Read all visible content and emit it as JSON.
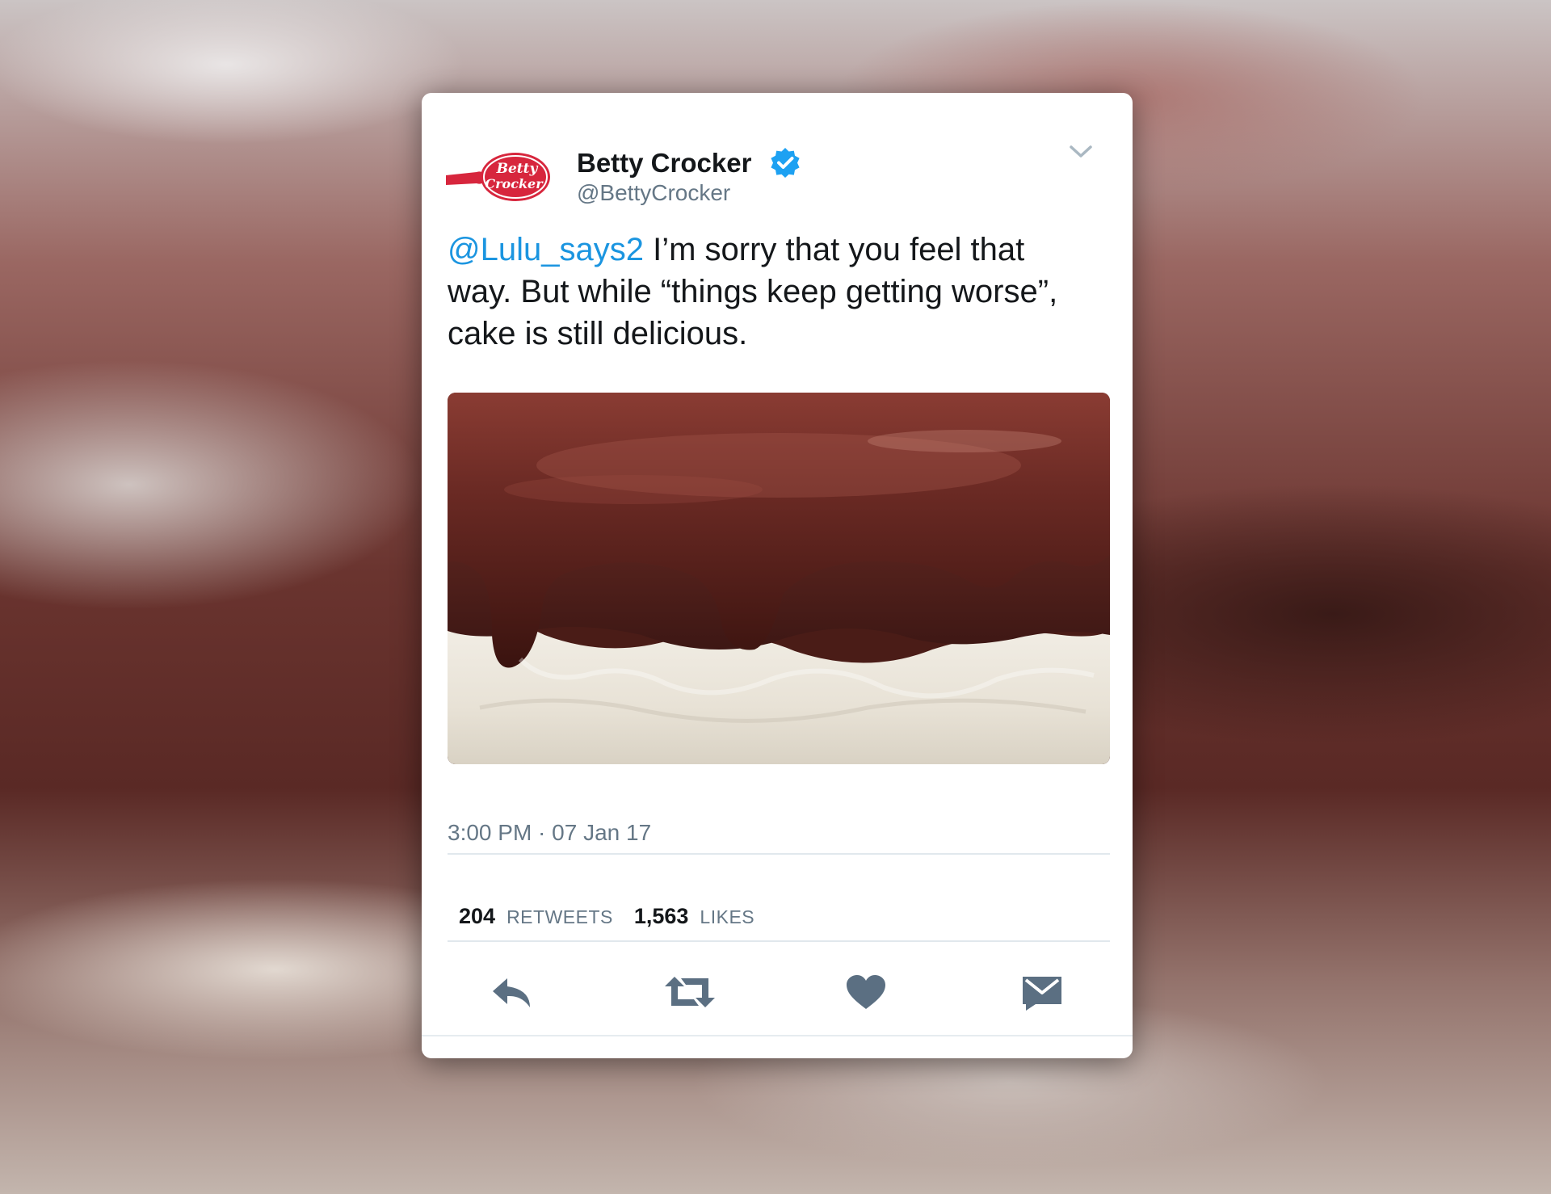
{
  "tweet": {
    "logo_text_line1": "Betty",
    "logo_text_line2": "Crocker",
    "author_name": "Betty Crocker",
    "author_handle": "@BettyCrocker",
    "mention": "@Lulu_says2",
    "text_line1": " I’m sorry that you feel that",
    "text_line2": "way. But while “things keep getting worse”,",
    "text_line3": "cake is still delicious.",
    "timestamp": "3:00 PM · 07 Jan 17",
    "retweet_count": "204",
    "retweet_label": "RETWEETS",
    "like_count": "1,563",
    "like_label": "LIKES"
  },
  "colors": {
    "link_blue": "#1b95e0",
    "verified_blue": "#1da1f2",
    "icon_gray": "#5b6f82",
    "brand_red": "#d7263d"
  },
  "icons": {
    "chevron": "chevron-down-icon",
    "verified": "verified-badge-icon",
    "reply": "reply-icon",
    "retweet": "retweet-icon",
    "like": "heart-icon",
    "message": "envelope-icon"
  }
}
